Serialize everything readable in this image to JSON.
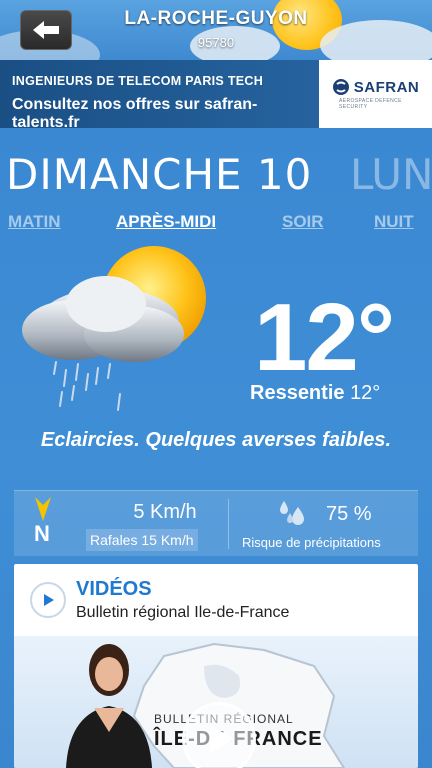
{
  "header": {
    "city": "LA-ROCHE-GUYON",
    "zip": "95780"
  },
  "ad": {
    "line1": "INGENIEURS DE TELECOM PARIS TECH",
    "line2": "Consultez nos offres sur safran-talents.fr",
    "logo_name": "SAFRAN",
    "logo_sub": "AEROSPACE  DEFENCE  SECURITY"
  },
  "days": {
    "current": "DIMANCHE 10",
    "next": "LUN"
  },
  "periods": [
    {
      "label": "MATIN",
      "active": false
    },
    {
      "label": "APRÈS-MIDI",
      "active": true
    },
    {
      "label": "SOIR",
      "active": false
    },
    {
      "label": "NUIT",
      "active": false
    }
  ],
  "weather": {
    "icon": "sun-cloud-rain-icon",
    "temperature": "12°",
    "feels_label": "Ressentie",
    "feels_value": "12°",
    "description": "Eclaircies. Quelques averses faibles."
  },
  "wind": {
    "direction": "N",
    "speed": "5 Km/h",
    "gusts": "Rafales 15 Km/h"
  },
  "precipitation": {
    "value": "75 %",
    "label": "Risque de précipitations"
  },
  "videos": {
    "title": "VIDÉOS",
    "subtitle": "Bulletin régional Ile-de-France",
    "thumb_line1": "BULLETIN RÉGIONAL",
    "thumb_line2": "ÎLE-DE-FRANCE"
  },
  "colors": {
    "background": "#3b8ad3",
    "ad_bg": "#1a4f84",
    "accent_blue": "#2079d0",
    "wind_arrow": "#f5c400"
  }
}
